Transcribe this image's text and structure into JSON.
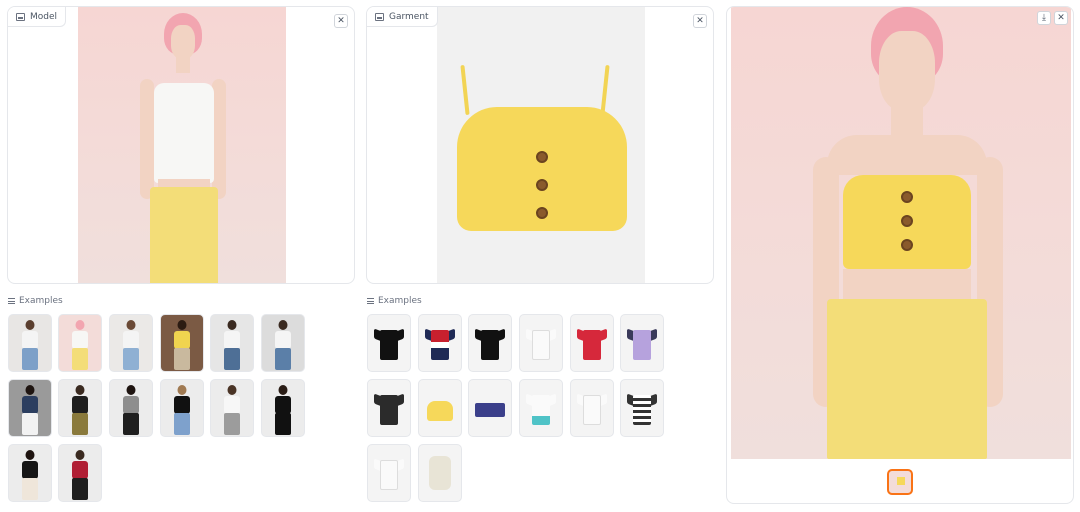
{
  "model_panel": {
    "label": "Model",
    "icon": "image-icon",
    "clear_icon": "close-icon"
  },
  "garment_panel": {
    "label": "Garment",
    "icon": "image-icon",
    "clear_icon": "close-icon"
  },
  "result_panel": {
    "download_icon": "download-icon",
    "clear_icon": "close-icon"
  },
  "model_examples": {
    "label": "Examples",
    "count": 14
  },
  "garment_examples": {
    "label": "Examples",
    "count": 14
  },
  "colors": {
    "accent": "#f97316",
    "border": "#e5e7eb",
    "pink_bg": "#f3dcd9",
    "yellow": "#f6d85a"
  },
  "glyphs": {
    "close": "✕",
    "download": "⤓"
  }
}
